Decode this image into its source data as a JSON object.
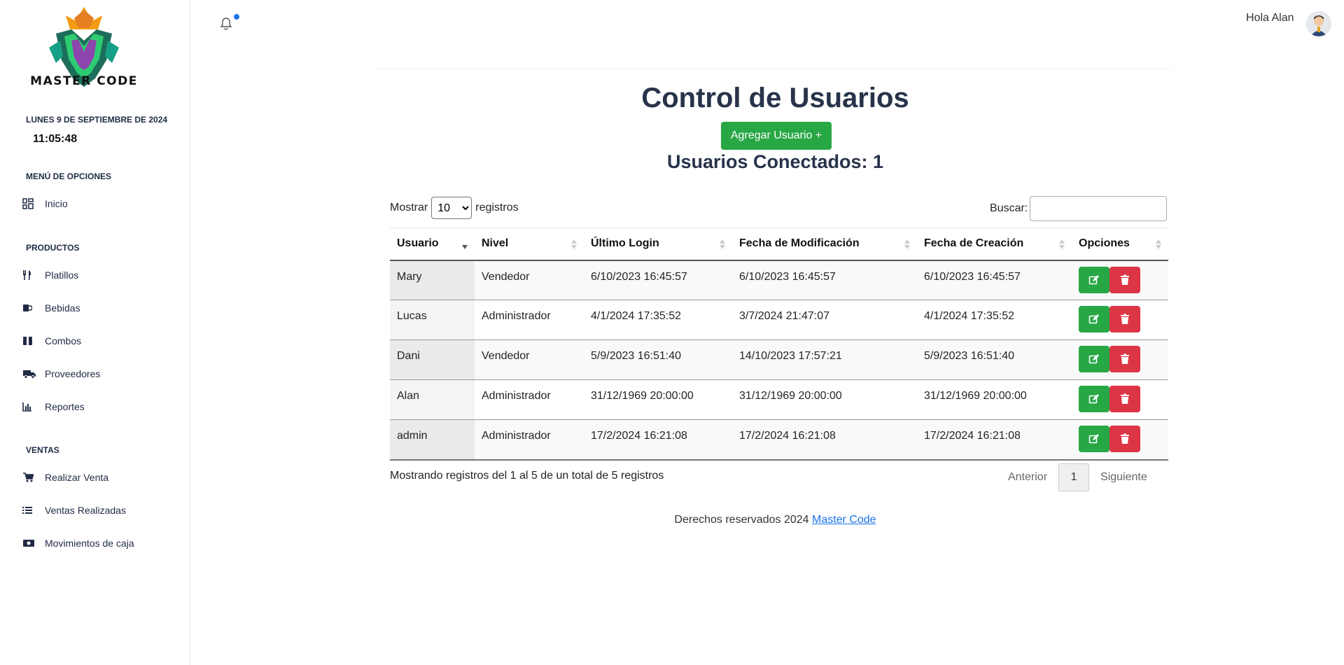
{
  "brand": {
    "name": "MASTER CODE"
  },
  "sidebar": {
    "date": "LUNES 9 DE SEPTIEMBRE DE 2024",
    "time": "11:05:48",
    "sections": {
      "menu": "MENÚ DE OPCIONES",
      "productos": "PRODUCTOS",
      "ventas": "VENTAS"
    },
    "items": {
      "inicio": "Inicio",
      "platillos": "Platillos",
      "bebidas": "Bebidas",
      "combos": "Combos",
      "proveedores": "Proveedores",
      "reportes": "Reportes",
      "realizar_venta": "Realizar Venta",
      "ventas_realizadas": "Ventas Realizadas",
      "movimientos": "Movimientos de caja"
    }
  },
  "header": {
    "greeting": "Hola Alan",
    "notification_icon": "bell-icon"
  },
  "main": {
    "title": "Control de Usuarios",
    "add_button": "Agregar Usuario +",
    "connected": "Usuarios Conectados: 1",
    "show_label": "Mostrar",
    "show_value": "10",
    "records_label": "registros",
    "search_label": "Buscar:",
    "search_value": ""
  },
  "table": {
    "columns": [
      "Usuario",
      "Nivel",
      "Último Login",
      "Fecha de Modificación",
      "Fecha de Creación",
      "Opciones"
    ],
    "rows": [
      [
        "Mary",
        "Vendedor",
        "6/10/2023 16:45:57",
        "6/10/2023 16:45:57",
        "6/10/2023 16:45:57"
      ],
      [
        "Lucas",
        "Administrador",
        "4/1/2024 17:35:52",
        "3/7/2024 21:47:07",
        "4/1/2024 17:35:52"
      ],
      [
        "Dani",
        "Vendedor",
        "5/9/2023 16:51:40",
        "14/10/2023 17:57:21",
        "5/9/2023 16:51:40"
      ],
      [
        "Alan",
        "Administrador",
        "31/12/1969 20:00:00",
        "31/12/1969 20:00:00",
        "31/12/1969 20:00:00"
      ],
      [
        "admin",
        "Administrador",
        "17/2/2024 16:21:08",
        "17/2/2024 16:21:08",
        "17/2/2024 16:21:08"
      ]
    ]
  },
  "pagination": {
    "info": "Mostrando registros del 1 al 5 de un total de 5 registros",
    "prev": "Anterior",
    "current": "1",
    "next": "Siguiente"
  },
  "footer": {
    "text": "Derechos reservados 2024",
    "link": "Master Code"
  },
  "colors": {
    "success": "#28a745",
    "danger": "#dc3545",
    "link": "#1a73e8",
    "heading": "#27334a"
  }
}
